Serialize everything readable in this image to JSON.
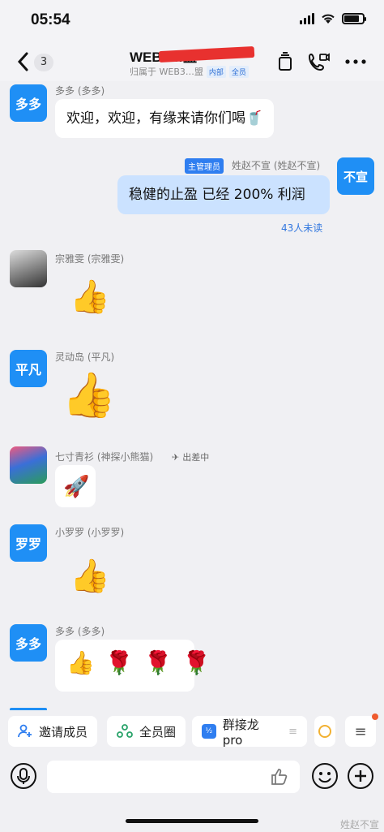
{
  "status": {
    "time": "05:54"
  },
  "nav": {
    "back_count": "3",
    "title": "WEB3…盟",
    "subtitle_prefix": "归属于 WEB3…盟",
    "tag_internal": "内部",
    "tag_all": "全员"
  },
  "messages": [
    {
      "sender": "多多 (多多)",
      "avatar": "多多",
      "text": "欢迎，欢迎，有缘来请你们喝🥤"
    },
    {
      "sender": "姓赵不宣 (姓赵不宣)",
      "role": "主管理员",
      "avatar": "不宣",
      "text": "稳健的止盈 已经 200% 利润",
      "unread": "43人未读"
    },
    {
      "sender": "宗雅雯 (宗雅雯)",
      "emoji": "👍"
    },
    {
      "sender": "灵动岛 (平凡)",
      "avatar": "平凡",
      "emoji": "👍"
    },
    {
      "sender": "七寸青衫 (神探小熊猫)",
      "status": "出差中",
      "emoji": "🚀"
    },
    {
      "sender": "小罗罗 (小罗罗)",
      "avatar": "罗罗",
      "emoji": "👍"
    },
    {
      "sender": "多多 (多多)",
      "avatar": "多多",
      "emoji": "👍 🌹 🌹 🌹"
    }
  ],
  "quick": {
    "invite": "邀请成员",
    "circle": "全员圈",
    "relay": "群接龙 pro"
  },
  "watermark": "姓赵不宣",
  "colors": {
    "accent": "#1f8ff5",
    "mine_bubble": "#cbe2ff"
  }
}
